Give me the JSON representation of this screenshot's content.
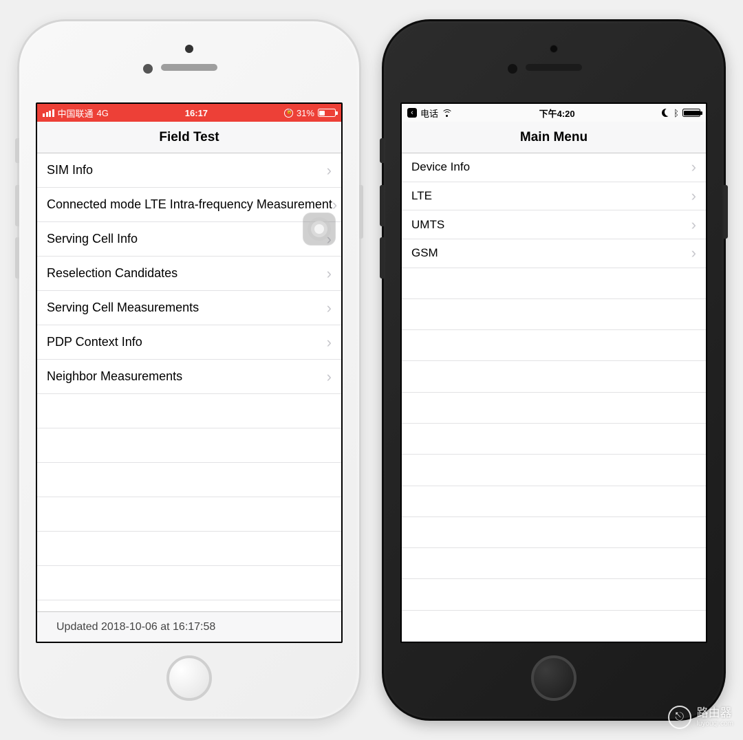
{
  "left": {
    "status": {
      "carrier": "中国联通",
      "net": "4G",
      "time": "16:17",
      "battery_pct": "31%",
      "battery_fill": "31%"
    },
    "title": "Field Test",
    "items": [
      "SIM Info",
      "Connected mode LTE Intra-frequency Measurement",
      "Serving Cell Info",
      "Reselection Candidates",
      "Serving Cell Measurements",
      "PDP Context Info",
      "Neighbor Measurements"
    ],
    "footer": "Updated 2018-10-06 at 16:17:58"
  },
  "right": {
    "status": {
      "back_label": "电话",
      "time": "下午4:20"
    },
    "title": "Main Menu",
    "items": [
      "Device Info",
      "LTE",
      "UMTS",
      "GSM"
    ]
  },
  "watermark": {
    "label": "路由器",
    "domain": "luyouqi.com"
  }
}
